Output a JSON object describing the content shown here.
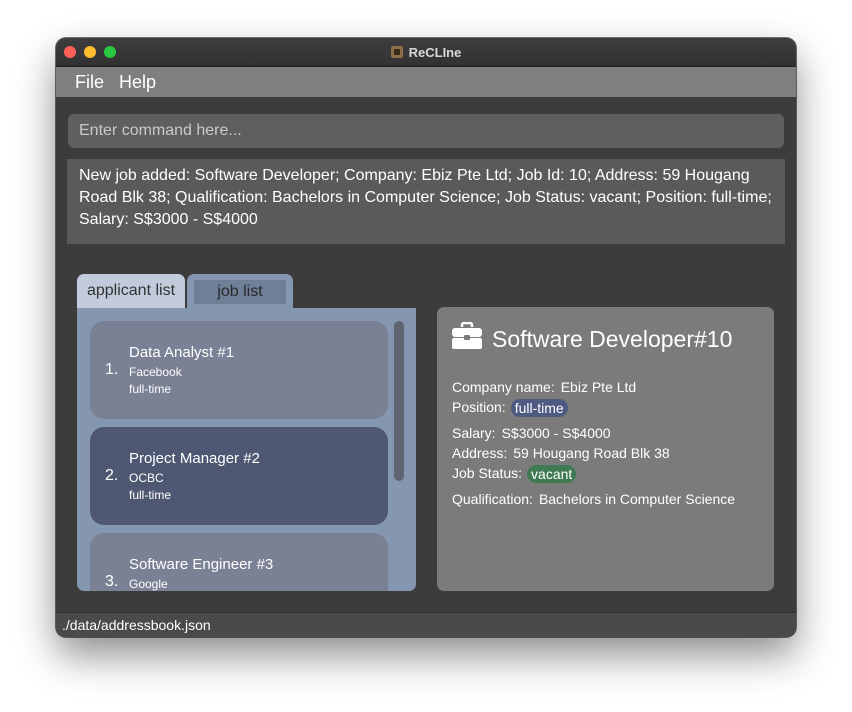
{
  "window": {
    "title": "ReCLIne"
  },
  "menu": {
    "file": "File",
    "help": "Help"
  },
  "command": {
    "placeholder": "Enter command here..."
  },
  "result": {
    "text": "New job added: Software Developer; Company: Ebiz Pte Ltd; Job Id: 10; Address: 59 Hougang Road Blk 38; Qualification: Bachelors in Computer Science; Job Status: vacant; Position: full-time; Salary: S$3000 - S$4000"
  },
  "tabs": [
    {
      "label": "applicant list"
    },
    {
      "label": "job list"
    }
  ],
  "applicants": [
    {
      "index": "1.",
      "title": "Data Analyst  #1",
      "company": "Facebook",
      "type": "full-time"
    },
    {
      "index": "2.",
      "title": "Project Manager  #2",
      "company": "OCBC",
      "type": "full-time"
    },
    {
      "index": "3.",
      "title": "Software Engineer  #3",
      "company": "Google",
      "type": ""
    }
  ],
  "detail": {
    "icon": "briefcase-icon",
    "title": "Software Developer#10",
    "company_label": "Company name:",
    "company": "Ebiz Pte Ltd",
    "position_label": "Position:",
    "position": "full-time",
    "salary_label": "Salary:",
    "salary": "S$3000 - S$4000",
    "address_label": "Address:",
    "address": "59 Hougang Road Blk 38",
    "status_label": "Job Status:",
    "status": "vacant",
    "qualification_label": "Qualification:",
    "qualification": "Bachelors in Computer Science"
  },
  "statusbar": {
    "path": "./data/addressbook.json"
  },
  "colors": {
    "position_pill": "#4f5a82",
    "status_pill": "#3e7b52",
    "list_panel": "#8597b0"
  }
}
